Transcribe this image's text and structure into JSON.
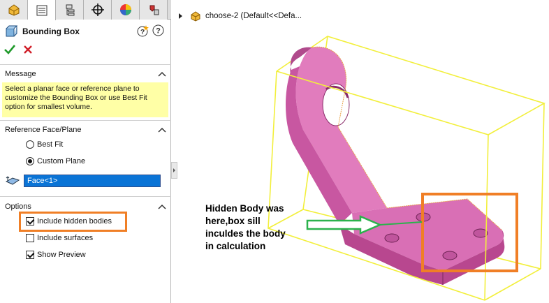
{
  "panel": {
    "tabs": [
      {
        "icon": "feature-manager-icon"
      },
      {
        "icon": "property-manager-icon"
      },
      {
        "icon": "configuration-manager-icon"
      },
      {
        "icon": "dimxpert-icon"
      },
      {
        "icon": "display-manager-icon"
      },
      {
        "icon": "cam-icon"
      }
    ],
    "title": "Bounding Box",
    "message": {
      "heading": "Message",
      "text": "Select a planar face or reference plane to customize the Bounding Box or use Best Fit option for smallest volume."
    },
    "reference": {
      "heading": "Reference Face/Plane",
      "best_fit_label": "Best Fit",
      "custom_plane_label": "Custom Plane",
      "selected": "Custom Plane",
      "face_value": "Face<1>"
    },
    "options": {
      "heading": "Options",
      "include_hidden_label": "Include hidden bodies",
      "include_hidden_checked": true,
      "include_surfaces_label": "Include surfaces",
      "include_surfaces_checked": false,
      "show_preview_label": "Show Preview",
      "show_preview_checked": true
    }
  },
  "viewport": {
    "tree_text": "choose-2  (Default<<Defa...",
    "annotation": {
      "lines": [
        "Hidden Body was",
        "here,box sill",
        "inculdes the body",
        "in calculation"
      ]
    }
  },
  "colors": {
    "highlight_orange": "#f07f26",
    "bounding_box_yellow": "#f2ef3b",
    "part_pink": "#d96fb5",
    "arrow_green": "#2bb24c",
    "message_yellow": "#ffffa6",
    "selection_blue": "#0a74d6"
  }
}
